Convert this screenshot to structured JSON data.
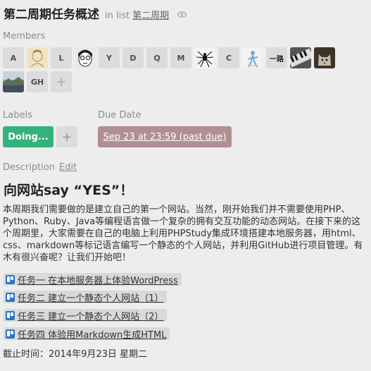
{
  "card": {
    "title": "第二周期任务概述",
    "in_list_prefix": "in list",
    "list_name": "第二周期"
  },
  "members": {
    "label": "Members",
    "items": [
      {
        "initials": "A",
        "kind": "initials"
      },
      {
        "initials": "",
        "kind": "avatar",
        "icon": "sketch-avatar-icon"
      },
      {
        "initials": "L",
        "kind": "initials"
      },
      {
        "initials": "",
        "kind": "avatar",
        "icon": "cartoon-face-avatar-icon"
      },
      {
        "initials": "Y",
        "kind": "initials"
      },
      {
        "initials": "D",
        "kind": "initials"
      },
      {
        "initials": "Q",
        "kind": "initials"
      },
      {
        "initials": "M",
        "kind": "initials"
      },
      {
        "initials": "",
        "kind": "avatar",
        "icon": "spider-avatar-icon"
      },
      {
        "initials": "C",
        "kind": "initials"
      },
      {
        "initials": "",
        "kind": "avatar",
        "icon": "figure-avatar-icon"
      },
      {
        "initials": "一路",
        "kind": "initials"
      },
      {
        "initials": "",
        "kind": "avatar",
        "icon": "piano-keys-avatar-icon"
      },
      {
        "initials": "",
        "kind": "avatar",
        "icon": "cat-avatar-icon"
      },
      {
        "initials": "",
        "kind": "avatar",
        "icon": "landscape-avatar-icon"
      },
      {
        "initials": "GH",
        "kind": "initials"
      }
    ],
    "add_symbol": "+"
  },
  "labels": {
    "label": "Labels",
    "items": [
      {
        "text": "Doing...",
        "color": "#34b27d"
      }
    ],
    "add_symbol": "+"
  },
  "due": {
    "label": "Due Date",
    "value": "Sep 23 at 23:59 (past due)",
    "color": "#b08f92"
  },
  "description": {
    "label": "Description",
    "edit": "Edit",
    "heading": "向网站say “YES”！",
    "body": "本周期我们需要做的是建立自己的第一个网站。当然，刚开始我们并不需要使用PHP、Python、Ruby、Java等编程语言做一个复杂的拥有交互功能的动态网站。在接下来的这个周期里，大家需要在自己的电脑上利用PHPStudy集成环境搭建本地服务器，用html、css、markdown等标记语言编写一个静态的个人网站，并利用GitHub进行项目管理。有木有很兴奋呢？让我们开始吧！",
    "tasks": [
      "任务一 在本地服务器上体验WordPress",
      "任务二 建立一个静态个人网站（1）",
      "任务三 建立一个静态个人网站（2）",
      "任务四 体验用Markdown生成HTML"
    ],
    "deadline": "截止时间：2014年9月23日 星期二"
  }
}
